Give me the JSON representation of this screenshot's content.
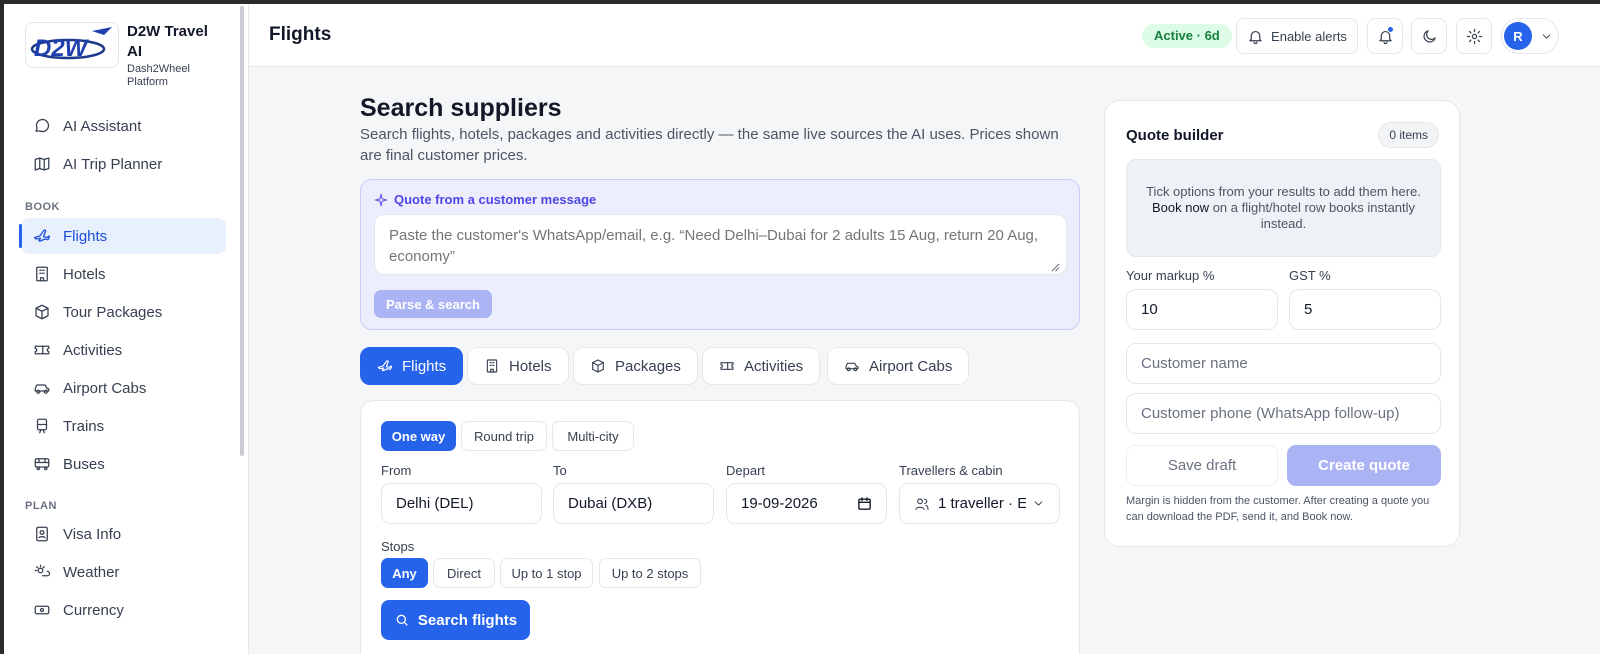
{
  "brand": {
    "title": "D2W Travel AI",
    "subtitle": "Dash2Wheel Platform",
    "logo_text": "D2W"
  },
  "sidebar": {
    "top_items": [
      {
        "label": "AI Assistant",
        "icon": "chat-bubble-icon"
      },
      {
        "label": "AI Trip Planner",
        "icon": "map-icon"
      }
    ],
    "book_label": "BOOK",
    "book_items": [
      {
        "label": "Flights",
        "icon": "plane-icon",
        "active": true
      },
      {
        "label": "Hotels",
        "icon": "building-icon"
      },
      {
        "label": "Tour Packages",
        "icon": "package-icon"
      },
      {
        "label": "Activities",
        "icon": "ticket-icon"
      },
      {
        "label": "Airport Cabs",
        "icon": "car-icon"
      },
      {
        "label": "Trains",
        "icon": "train-icon"
      },
      {
        "label": "Buses",
        "icon": "bus-icon"
      }
    ],
    "plan_label": "PLAN",
    "plan_items": [
      {
        "label": "Visa Info",
        "icon": "id-card-icon"
      },
      {
        "label": "Weather",
        "icon": "weather-icon"
      },
      {
        "label": "Currency",
        "icon": "banknote-icon"
      }
    ]
  },
  "header": {
    "title": "Flights",
    "status": "Active · 6d",
    "enable_alerts": "Enable alerts",
    "avatar_initial": "R"
  },
  "main": {
    "title": "Search suppliers",
    "subtitle": "Search flights, hotels, packages and activities directly — the same live sources the AI uses. Prices shown are final customer prices.",
    "quote_message": {
      "label": "Quote from a customer message",
      "placeholder": "Paste the customer's WhatsApp/email, e.g. “Need Delhi–Dubai for 2 adults 15 Aug, return 20 Aug, economy”",
      "parse_button": "Parse & search"
    },
    "tabs": [
      {
        "label": "Flights",
        "active": true
      },
      {
        "label": "Hotels"
      },
      {
        "label": "Packages"
      },
      {
        "label": "Activities"
      },
      {
        "label": "Airport Cabs"
      }
    ],
    "search": {
      "trip_types": [
        "One way",
        "Round trip",
        "Multi-city"
      ],
      "trip_type_selected": "One way",
      "from_label": "From",
      "from_value": "Delhi (DEL)",
      "to_label": "To",
      "to_value": "Dubai (DXB)",
      "depart_label": "Depart",
      "depart_value": "19-09-2026",
      "travellers_label": "Travellers & cabin",
      "travellers_value": "1 traveller · E",
      "stops_label": "Stops",
      "stops": [
        "Any",
        "Direct",
        "Up to 1 stop",
        "Up to 2 stops"
      ],
      "stops_selected": "Any",
      "search_button": "Search flights"
    }
  },
  "quote_builder": {
    "title": "Quote builder",
    "count": "0 items",
    "empty_text_1": "Tick options from your results to add them here.",
    "empty_bold": "Book now",
    "empty_text_2": "on a flight/hotel row books instantly instead.",
    "markup_label": "Your markup %",
    "markup_value": "10",
    "gst_label": "GST %",
    "gst_value": "5",
    "customer_name_placeholder": "Customer name",
    "customer_phone_placeholder": "Customer phone (WhatsApp follow-up)",
    "save_draft": "Save draft",
    "create_quote": "Create quote",
    "note": "Margin is hidden from the customer. After creating a quote you can download the PDF, send it, and Book now."
  },
  "colors": {
    "accent": "#2563eb",
    "active_bg": "#e8f0fe",
    "status_bg": "#dcfce7",
    "status_fg": "#15803d",
    "disabled_accent": "#aab3f3"
  }
}
